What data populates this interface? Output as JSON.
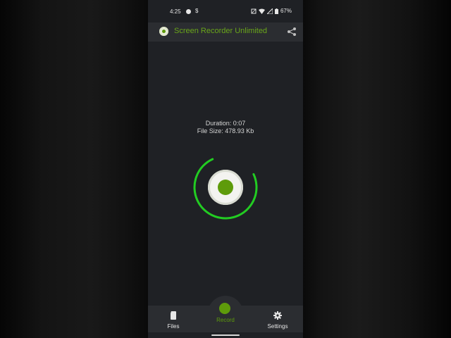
{
  "status_bar": {
    "time": "4:25",
    "app_icon": "$",
    "battery": "67%"
  },
  "app_bar": {
    "title": "Screen Recorder Unlimited",
    "accent_color": "#6aa61a"
  },
  "recording": {
    "duration": "Duration: 0:07",
    "file_size": "File Size: 478.93 Kb",
    "progress_fraction": 0.75,
    "ring_color": "#22cc22"
  },
  "bottom_nav": {
    "files": "Files",
    "record": "Record",
    "settings": "Settings"
  },
  "icons": [
    "dot-icon",
    "wifi-icon",
    "signal-icon",
    "battery-icon",
    "share-icon",
    "file-icon",
    "record-icon",
    "gear-icon"
  ]
}
